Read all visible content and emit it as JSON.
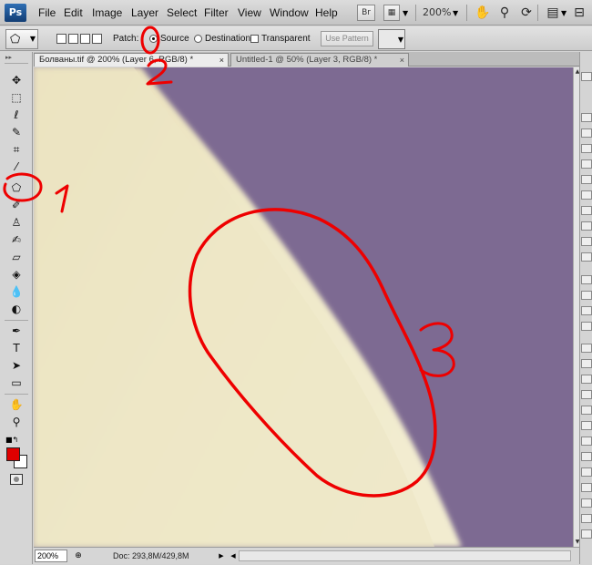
{
  "app": {
    "logo": "Ps"
  },
  "menu": [
    "File",
    "Edit",
    "Image",
    "Layer",
    "Select",
    "Filter",
    "View",
    "Window",
    "Help"
  ],
  "menubar": {
    "bridge_label": "Br",
    "zoom": "200%",
    "icons": [
      "bridge-icon",
      "view-extras-icon",
      "hand-icon",
      "zoom-icon",
      "rotate-view-icon",
      "arrange-documents-icon",
      "screen-mode-icon"
    ]
  },
  "options": {
    "patch_label": "Patch:",
    "source_label": "Source",
    "destination_label": "Destination",
    "transparent_label": "Transparent",
    "use_pattern_label": "Use Pattern",
    "source_selected": true
  },
  "tabs": [
    {
      "label": "Болваны.tif @ 200% (Layer 6, RGB/8) *",
      "active": true
    },
    {
      "label": "Untitled-1 @ 50% (Layer 3, RGB/8) *",
      "active": false
    }
  ],
  "status": {
    "zoom": "200%",
    "doc_info": "Doc: 293,8M/429,8M"
  },
  "colors": {
    "foreground": "#e00000",
    "background": "#ffffff",
    "canvas_purple": "#7d6a92",
    "skin": "#ede6c4",
    "annotation_red": "#ee0000"
  },
  "annotations": [
    "1",
    "2",
    "3"
  ]
}
